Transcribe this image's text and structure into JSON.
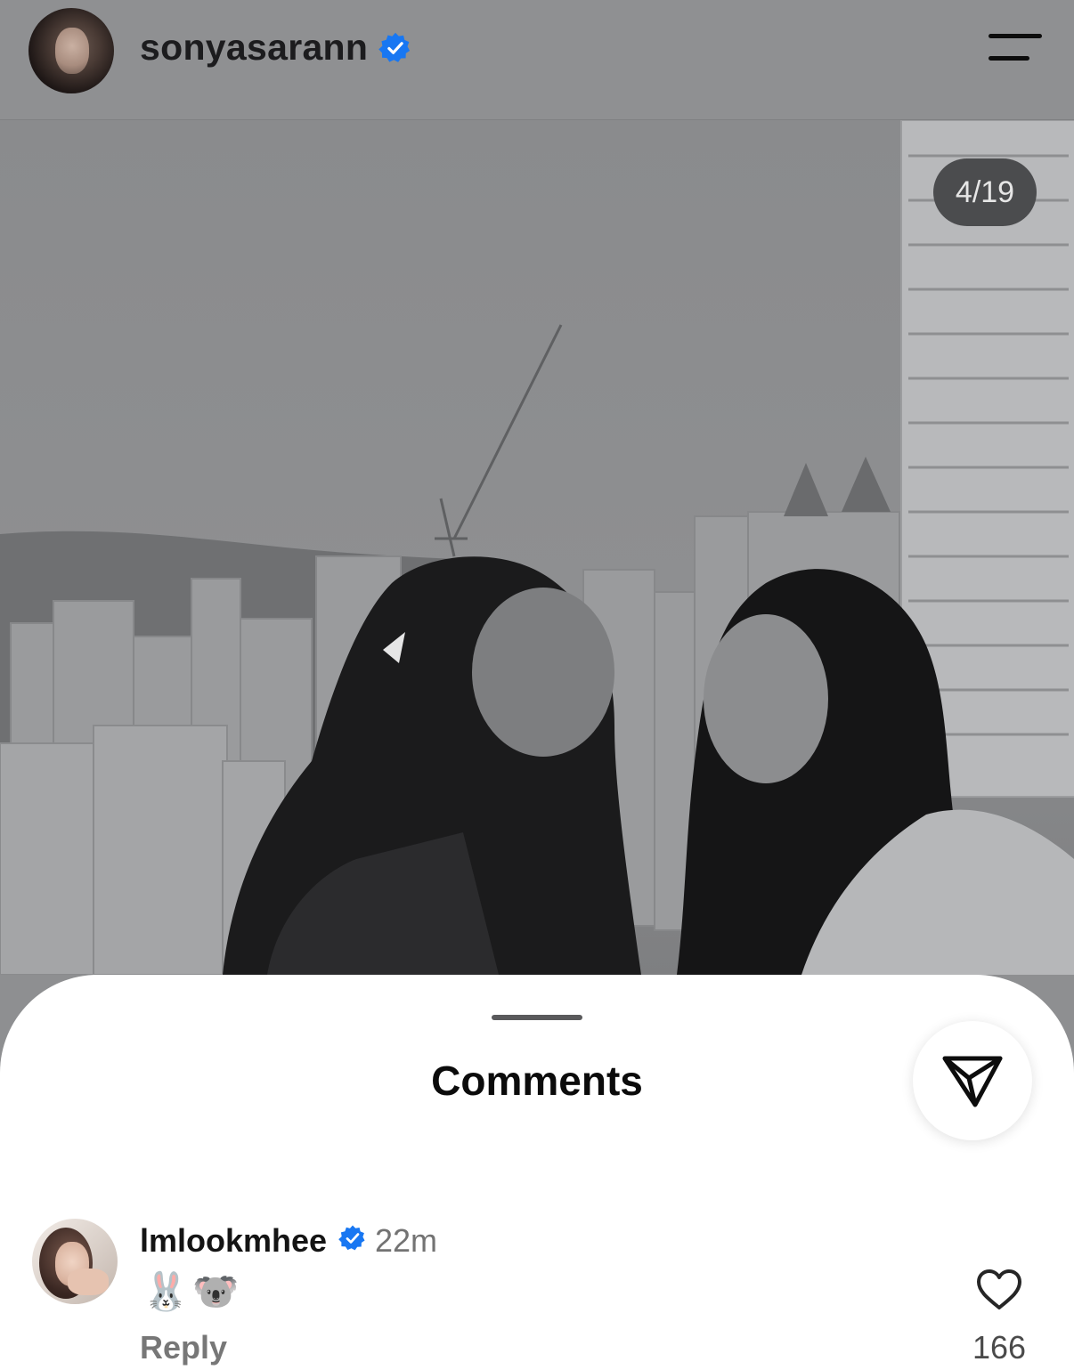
{
  "header": {
    "username": "sonyasarann",
    "verified": true
  },
  "photo": {
    "counter": "4/19",
    "style": "grayscale"
  },
  "comments_sheet": {
    "title": "Comments",
    "comment": {
      "username": "lmlookmhee",
      "verified": true,
      "time": "22m",
      "text": "🐰🐨",
      "reply_label": "Reply",
      "like_count": "166"
    }
  },
  "colors": {
    "verified_blue": "#1877f2",
    "sheet_bg": "#ffffff",
    "header_bg": "#8f9092",
    "counter_bg": "#4b4c4e"
  },
  "icons": [
    "verified-badge-icon",
    "menu-icon",
    "send-icon",
    "heart-icon"
  ]
}
